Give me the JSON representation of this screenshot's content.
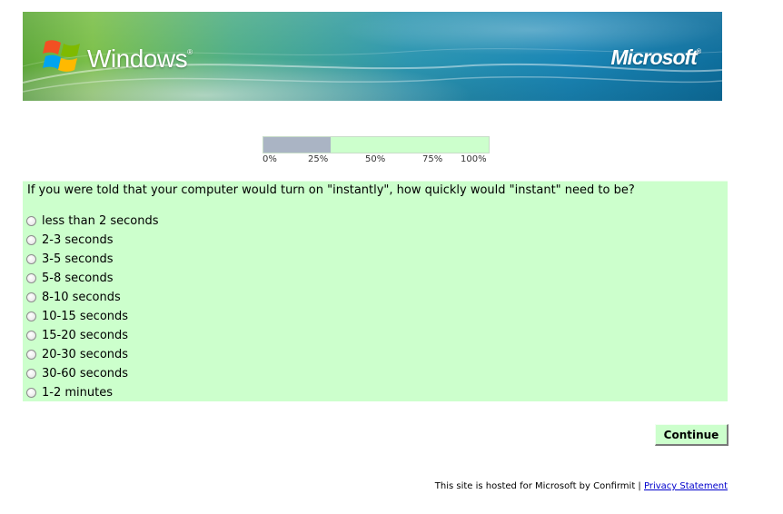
{
  "header": {
    "windows_logo_text": "Windows",
    "windows_logo_mark": "®",
    "microsoft_logo_text": "Microsoft",
    "microsoft_logo_mark": "®",
    "icons": [
      "windows-flag-icon"
    ]
  },
  "progress": {
    "value_percent": 30,
    "scale_labels": [
      "0%",
      "25%",
      "50%",
      "75%",
      "100%"
    ],
    "fill_color": "#aab4c4",
    "track_color": "#ccffcc"
  },
  "question": {
    "text": "If you were told that your computer would turn on \"instantly\", how quickly would \"instant\" need to be?",
    "options": [
      "less than 2 seconds",
      "2-3 seconds",
      "3-5 seconds",
      "5-8 seconds",
      "8-10 seconds",
      "10-15 seconds",
      "15-20 seconds",
      "20-30 seconds",
      "30-60 seconds",
      "1-2 minutes"
    ],
    "box_color": "#ccffcc"
  },
  "actions": {
    "continue_label": "Continue"
  },
  "footer": {
    "hosted_text": "This site is hosted for Microsoft by Confirmit |",
    "privacy_link": "Privacy Statement",
    "link_color": "#0000cc"
  }
}
